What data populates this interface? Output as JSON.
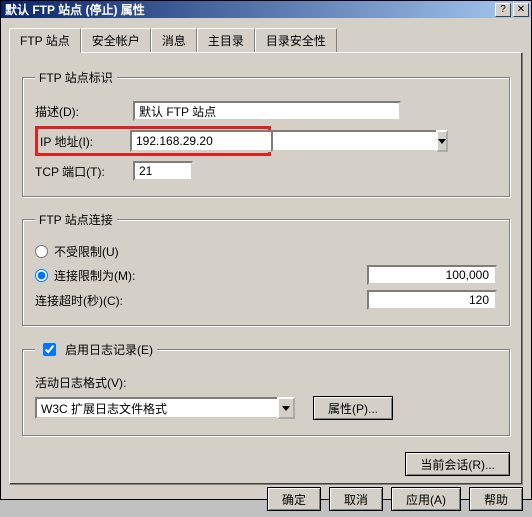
{
  "window": {
    "title": "默认 FTP 站点 (停止) 属性"
  },
  "tabs": [
    "FTP 站点",
    "安全帐户",
    "消息",
    "主目录",
    "目录安全性"
  ],
  "identity": {
    "legend": "FTP 站点标识",
    "desc_label": "描述(D):",
    "desc_value": "默认 FTP 站点",
    "ip_label": "IP 地址(I):",
    "ip_value": "192.168.29.20",
    "port_label": "TCP 端口(T):",
    "port_value": "21"
  },
  "connection": {
    "legend": "FTP 站点连接",
    "unlimited_label": "不受限制(U)",
    "limited_label": "连接限制为(M):",
    "limited_value": "100,000",
    "timeout_label": "连接超时(秒)(C):",
    "timeout_value": "120"
  },
  "logging": {
    "enable_label": "启用日志记录(E)",
    "format_label": "活动日志格式(V):",
    "format_value": "W3C 扩展日志文件格式",
    "props_button": "属性(P)..."
  },
  "session_button": "当前会话(R)...",
  "buttons": {
    "ok": "确定",
    "cancel": "取消",
    "apply": "应用(A)",
    "help": "帮助"
  }
}
